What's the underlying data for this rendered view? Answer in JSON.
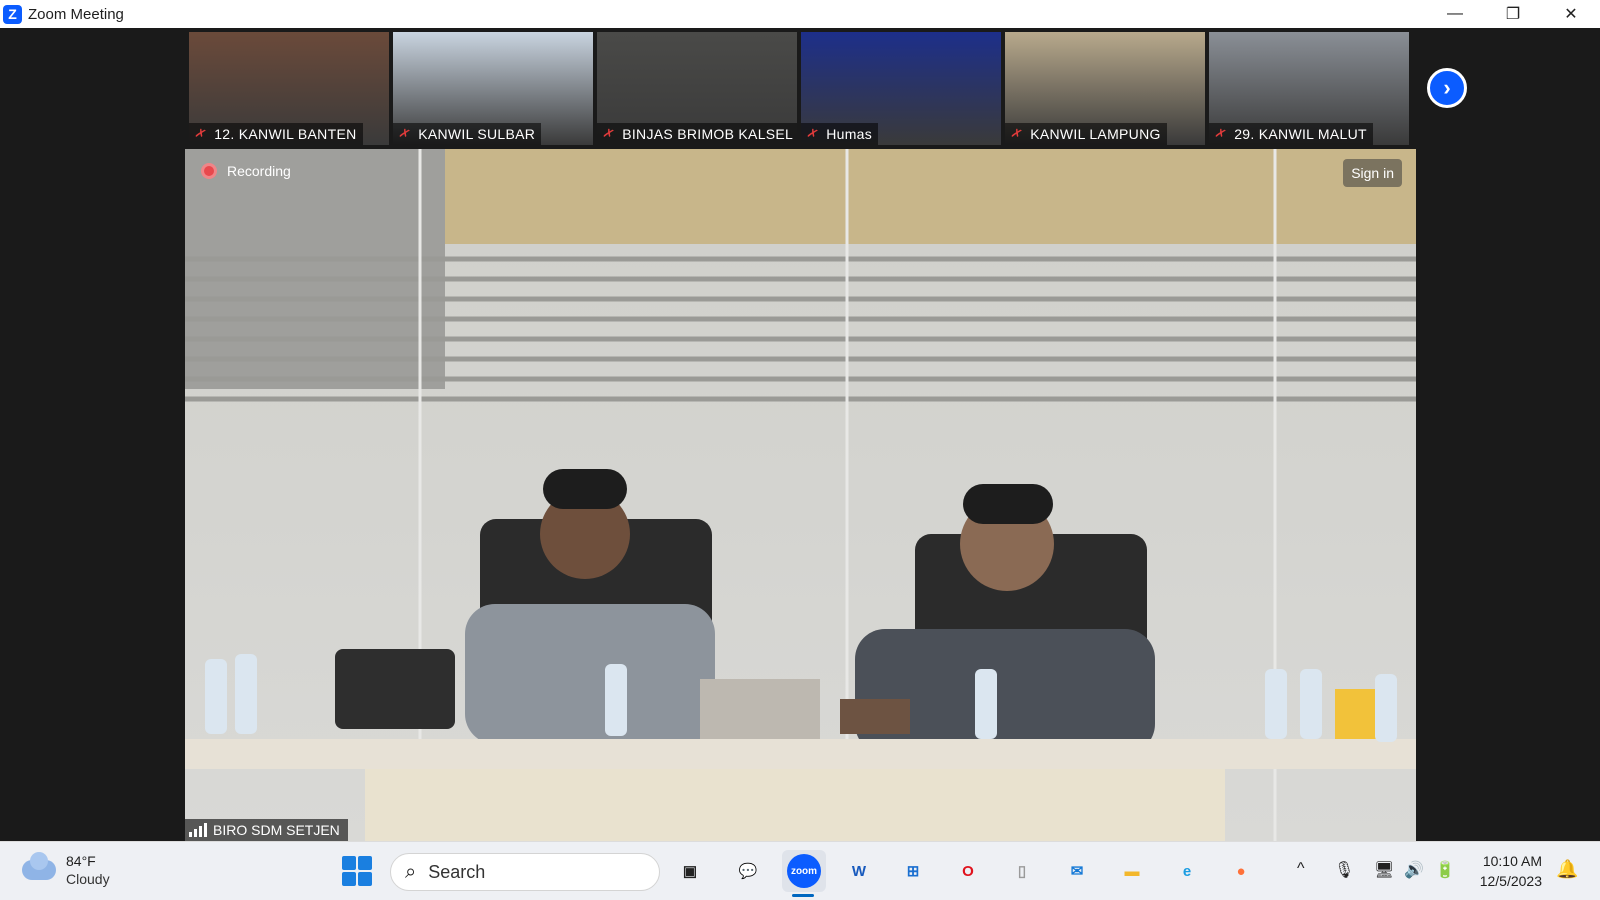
{
  "window": {
    "title": "Zoom Meeting",
    "logo_letter": "Z"
  },
  "window_controls": {
    "minimize": "—",
    "restore": "❐",
    "close": "✕"
  },
  "participants": [
    {
      "name": "12. KANWIL BANTEN",
      "muted": true,
      "scene_color": "#6b4a3a"
    },
    {
      "name": "KANWIL SULBAR",
      "muted": true,
      "scene_color": "#c9d4e0"
    },
    {
      "name": "BINJAS BRIMOB KALSEL",
      "muted": true,
      "scene_color": "#4a4a48"
    },
    {
      "name": "Humas",
      "muted": true,
      "scene_color": "#1d2f8a"
    },
    {
      "name": "KANWIL LAMPUNG",
      "muted": true,
      "scene_color": "#b8a98c"
    },
    {
      "name": "29. KANWIL MALUT",
      "muted": true,
      "scene_color": "#8a8f96"
    }
  ],
  "strip_next_icon": "›",
  "main": {
    "recording_label": "Recording",
    "sign_in_label": "Sign in",
    "speaker_name": "BIRO SDM SETJEN"
  },
  "taskbar": {
    "weather_temp": "84°F",
    "weather_condition": "Cloudy",
    "search_placeholder": "Search",
    "apps": [
      {
        "name": "task-view",
        "glyph": "▣",
        "color": "#222222"
      },
      {
        "name": "teams-chat",
        "glyph": "💬",
        "color": "#5b5fc7"
      },
      {
        "name": "zoom",
        "glyph": "zoom",
        "color": "#0b5cff"
      },
      {
        "name": "word",
        "glyph": "W",
        "color": "#185abd"
      },
      {
        "name": "store",
        "glyph": "⊞",
        "color": "#1a6fd0"
      },
      {
        "name": "opera",
        "glyph": "O",
        "color": "#e0121d"
      },
      {
        "name": "file",
        "glyph": "▯",
        "color": "#9a9a9a"
      },
      {
        "name": "mail",
        "glyph": "✉",
        "color": "#1579d6"
      },
      {
        "name": "file-explorer",
        "glyph": "▬",
        "color": "#f3b72b"
      },
      {
        "name": "edge",
        "glyph": "e",
        "color": "#1b9de2"
      },
      {
        "name": "firefox",
        "glyph": "●",
        "color": "#ff7139"
      }
    ],
    "tray": {
      "chevron": "^",
      "mic": "🎙",
      "network": "🖥",
      "volume": "🔊",
      "battery": "🔋"
    },
    "time": "10:10 AM",
    "date": "12/5/2023",
    "notification_glyph": "🔔"
  }
}
